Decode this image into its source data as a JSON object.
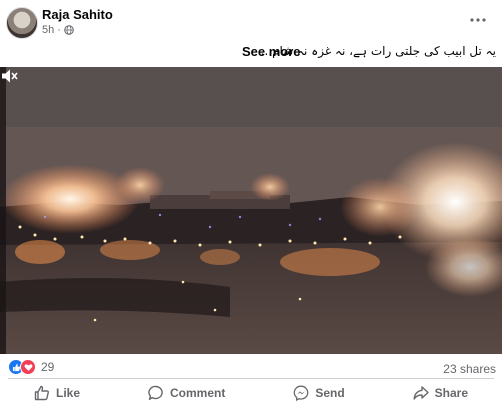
{
  "post": {
    "author": "Raja Sahito",
    "time": "5h",
    "visibility_icon": "globe-icon",
    "more_icon": "more-options-icon",
    "caption": "یہ تل ابیب کی جلتی رات ہے، نہ غزہ نہ شام...",
    "see_more": "See more"
  },
  "video": {
    "mute_icon": "sound-off-icon"
  },
  "stats": {
    "reaction_icons": [
      "like-icon",
      "love-icon"
    ],
    "reaction_count": "29",
    "shares": "23 shares"
  },
  "actions": [
    {
      "label": "Like",
      "icon": "thumbs-up-icon"
    },
    {
      "label": "Comment",
      "icon": "comment-icon"
    },
    {
      "label": "Send",
      "icon": "messenger-icon"
    },
    {
      "label": "Share",
      "icon": "share-icon"
    }
  ],
  "colors": {
    "text": "#050505",
    "secondary": "#65676b",
    "like_blue": "#1877f2",
    "love_red": "#f33e58"
  }
}
